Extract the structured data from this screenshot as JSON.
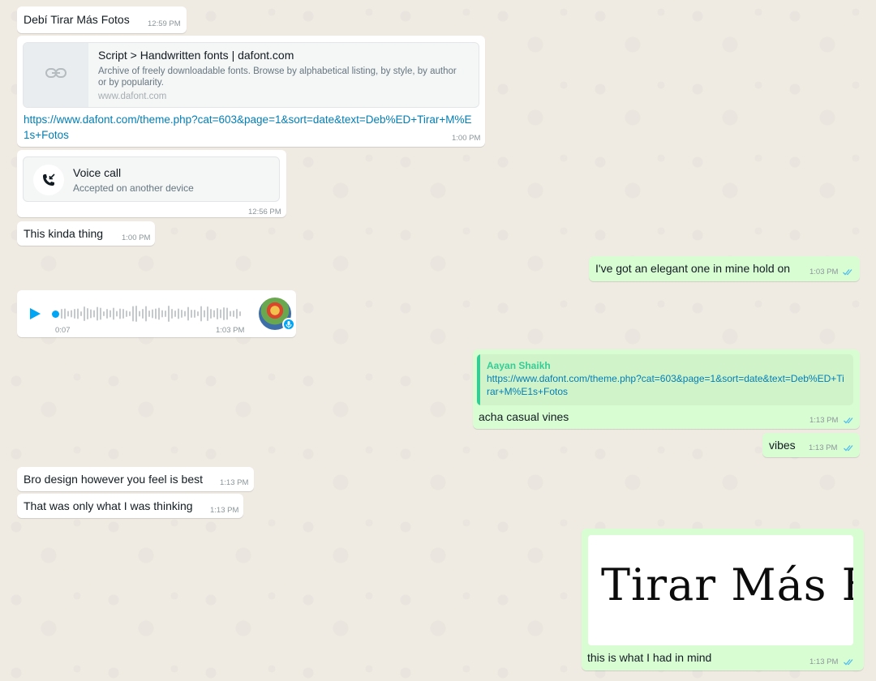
{
  "theme": {
    "incoming_bg": "#ffffff",
    "outgoing_bg": "#d9fdd3",
    "link_color": "#027eb5",
    "tick_color": "#53bdeb",
    "quote_author_color": "#35cd96",
    "play_color": "#00a5f4"
  },
  "messages": {
    "m1": {
      "text": "Debí Tirar Más Fotos",
      "time": "12:59 PM"
    },
    "m2": {
      "preview_title": "Script > Handwritten fonts | dafont.com",
      "preview_desc": "Archive of freely downloadable fonts. Browse by alphabetical listing, by style, by author or by popularity.",
      "preview_domain": "www.dafont.com",
      "preview_icon": "link-icon",
      "url": "https://www.dafont.com/theme.php?cat=603&page=1&sort=date&text=Deb%ED+Tirar+M%E1s+Fotos",
      "time": "1:00 PM"
    },
    "m3": {
      "title": "Voice call",
      "subtitle": "Accepted on another device",
      "icon": "incoming-call-icon",
      "time": "12:56 PM"
    },
    "m4": {
      "text": "This kinda thing",
      "time": "1:00 PM"
    },
    "m5": {
      "text": "I've got an elegant one in mine hold on",
      "time": "1:03 PM"
    },
    "m6": {
      "duration": "0:07",
      "time": "1:03 PM",
      "icons": [
        "play-icon",
        "avatar",
        "microphone-icon"
      ]
    },
    "m7": {
      "quote_author": "Aayan Shaikh",
      "quote_text": "https://www.dafont.com/theme.php?cat=603&page=1&sort=date&text=Deb%ED+Tirar+M%E1s+Fotos",
      "text": "acha casual vines",
      "time": "1:13 PM"
    },
    "m8": {
      "text": "vibes",
      "time": "1:13 PM"
    },
    "m9": {
      "text": "Bro design however you feel is best",
      "time": "1:13 PM"
    },
    "m10": {
      "text": "That was only what I was thinking",
      "time": "1:13 PM"
    },
    "m11": {
      "image_text": "Tirar Más F",
      "caption": "this is what I had in mind",
      "time": "1:13 PM"
    }
  }
}
